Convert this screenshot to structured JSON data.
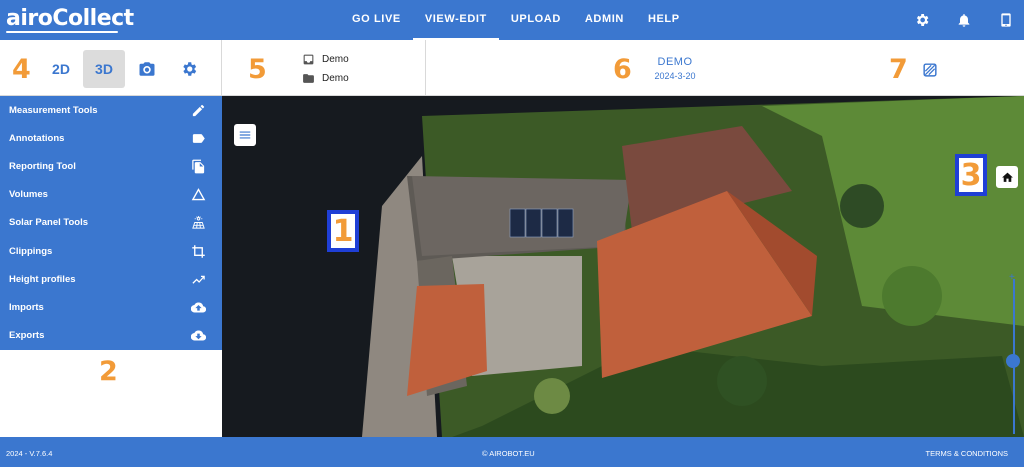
{
  "app": {
    "logo": "airoCollect"
  },
  "nav": {
    "items": [
      {
        "label": "GO LIVE"
      },
      {
        "label": "VIEW-EDIT"
      },
      {
        "label": "UPLOAD"
      },
      {
        "label": "ADMIN"
      },
      {
        "label": "HELP"
      }
    ],
    "active": "VIEW-EDIT",
    "icons": [
      "settings-icon",
      "bell-icon",
      "tablet-icon"
    ]
  },
  "toolbar": {
    "badges": {
      "four": "4",
      "five": "5",
      "six": "6",
      "seven": "7"
    },
    "view_2d": "2D",
    "view_3d": "3D",
    "active_view": "3D",
    "project": {
      "folder_label": "Demo",
      "subfolder_label": "Demo"
    },
    "title": "DEMO",
    "date": "2024-3-20"
  },
  "sidebar": {
    "items": [
      {
        "label": "Measurement Tools",
        "icon": "pencil-icon"
      },
      {
        "label": "Annotations",
        "icon": "tag-icon"
      },
      {
        "label": "Reporting Tool",
        "icon": "copy-icon"
      },
      {
        "label": "Volumes",
        "icon": "triangle-icon"
      },
      {
        "label": "Solar Panel Tools",
        "icon": "solar-panel-icon"
      },
      {
        "label": "Clippings",
        "icon": "crop-icon"
      },
      {
        "label": "Height profiles",
        "icon": "trend-icon"
      },
      {
        "label": "Imports",
        "icon": "cloud-upload-icon"
      },
      {
        "label": "Exports",
        "icon": "cloud-download-icon"
      }
    ],
    "badge": "2"
  },
  "viewer": {
    "marker_1": "1",
    "marker_3": "3"
  },
  "footer": {
    "version": "2024 - V.7.6.4",
    "copyright": "© AIROBOT.EU",
    "terms": "TERMS & CONDITIONS"
  },
  "colors": {
    "brand": "#3b77cf",
    "accent": "#f29b38",
    "marker_border": "#1f3fd6"
  }
}
